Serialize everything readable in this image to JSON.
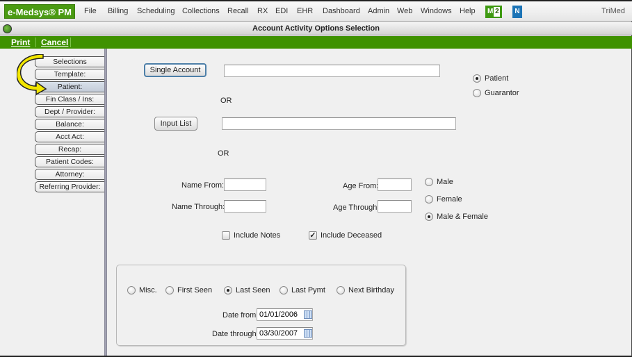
{
  "app": {
    "brand": "e-Medsys® PM",
    "vendor": "TriMed",
    "menu": [
      "File",
      "Billing",
      "Scheduling",
      "Collections",
      "Recall",
      "RX",
      "EDI",
      "EHR",
      "Dashboard",
      "Admin",
      "Web",
      "Windows",
      "Help"
    ],
    "badges": {
      "m_letter": "M",
      "m_count": "2",
      "n_letter": "N"
    }
  },
  "window": {
    "title": "Account Activity Options Selection"
  },
  "toolbar": {
    "print_label": "Print",
    "cancel_label": "Cancel"
  },
  "sidenav": {
    "active_index": 2,
    "items": [
      "Selections",
      "Template:",
      "Patient:",
      "Fin Class / Ins:",
      "Dept / Provider:",
      "Balance:",
      "Acct Act:",
      "Recap:",
      "Patient Codes:",
      "Attorney:",
      "Referring Provider:"
    ]
  },
  "form": {
    "single_account_label": "Single Account",
    "single_account_value": "",
    "or_label": "OR",
    "input_list_label": "Input List",
    "input_list_value": "",
    "account_type": {
      "options": [
        "Patient",
        "Guarantor"
      ],
      "selected": "Patient"
    },
    "name_from_label": "Name From:",
    "name_from_value": "",
    "name_through_label": "Name Through:",
    "name_through_value": "",
    "age_from_label": "Age From:",
    "age_from_value": "",
    "age_through_label": "Age Through:",
    "age_through_value": "",
    "gender": {
      "options": [
        "Male",
        "Female",
        "Male & Female"
      ],
      "selected": "Male & Female"
    },
    "include_notes_label": "Include Notes",
    "include_notes_checked": false,
    "include_deceased_label": "Include Deceased",
    "include_deceased_checked": true,
    "date_type": {
      "options": [
        "Misc.",
        "First Seen",
        "Last Seen",
        "Last Pymt",
        "Next Birthday"
      ],
      "selected": "Last Seen"
    },
    "date_from_label": "Date from:",
    "date_from_value": "01/01/2006",
    "date_through_label": "Date through:",
    "date_through_value": "03/30/2007"
  }
}
